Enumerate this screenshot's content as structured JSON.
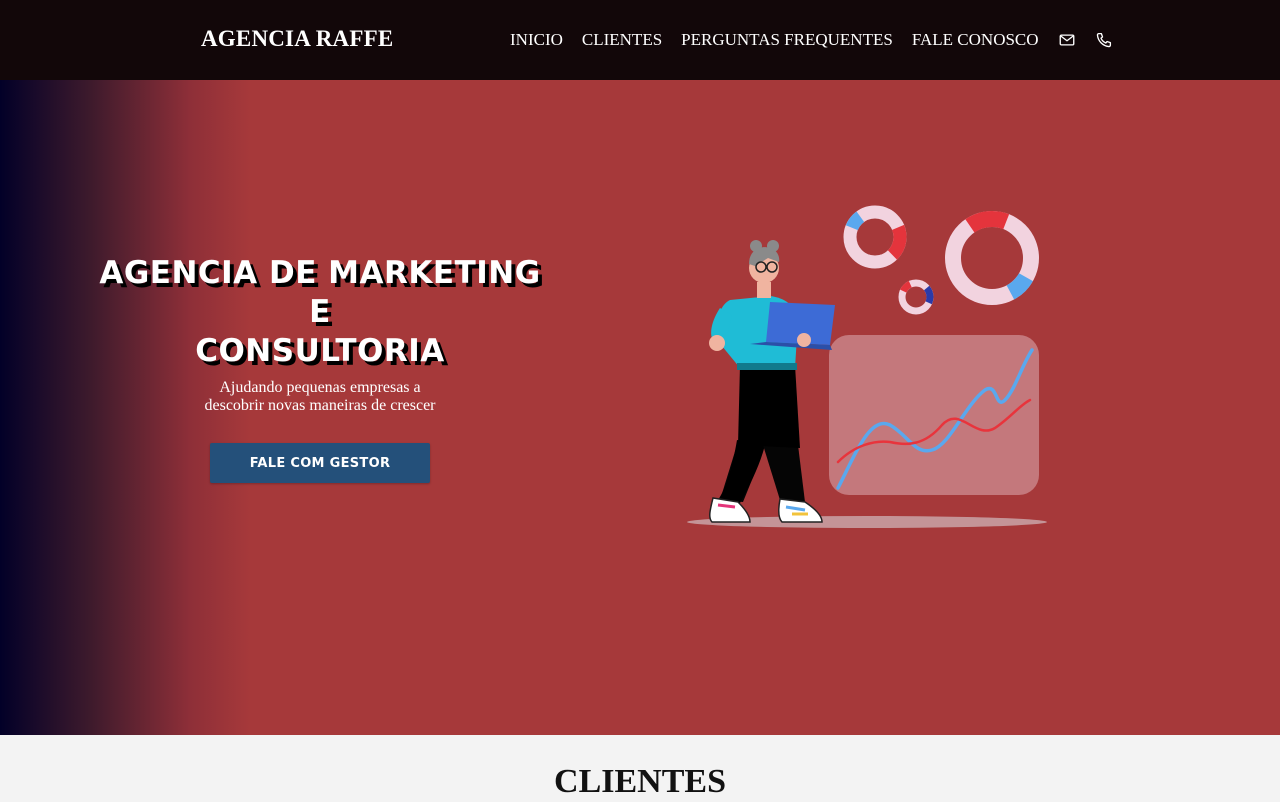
{
  "header": {
    "brand": "AGENCIA RAFFE",
    "nav": [
      "INICIO",
      "CLIENTES",
      "PERGUNTAS FREQUENTES",
      "FALE CONOSCO"
    ],
    "icons": [
      "mail-icon",
      "phone-icon"
    ]
  },
  "hero": {
    "title_lines": [
      "AGENCIA DE MARKETING",
      "E",
      "CONSULTORIA"
    ],
    "subtitle_lines": [
      "Ajudando pequenas empresas a",
      "descobrir novas maneiras de crescer"
    ],
    "cta_label": "FALE COM GESTOR"
  },
  "clients": {
    "title": "CLIENTES"
  },
  "colors": {
    "topbar": "#120709",
    "hero": "#a6393a",
    "hero_gradient_start": "#020028",
    "cta": "#24507a",
    "section_bg": "#f3f3f3"
  }
}
